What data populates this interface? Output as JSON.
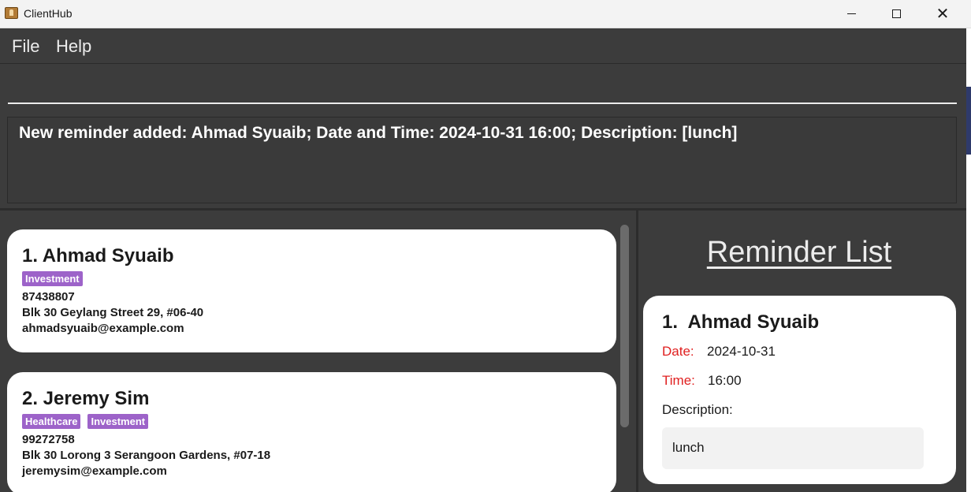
{
  "window": {
    "title": "ClientHub"
  },
  "menu": {
    "file": "File",
    "help": "Help"
  },
  "command": {
    "value": ""
  },
  "result": {
    "message": "New reminder added: Ahmad Syuaib; Date and Time: 2024-10-31 16:00; Description: [lunch]"
  },
  "persons": [
    {
      "index_name": "1. Ahmad Syuaib",
      "tags": [
        "Investment"
      ],
      "phone": "87438807",
      "address": "Blk 30 Geylang Street 29, #06-40",
      "email": "ahmadsyuaib@example.com"
    },
    {
      "index_name": "2. Jeremy Sim",
      "tags": [
        "Healthcare",
        "Investment"
      ],
      "phone": "99272758",
      "address": "Blk 30 Lorong 3 Serangoon Gardens, #07-18",
      "email": "jeremysim@example.com"
    }
  ],
  "reminders": {
    "heading": "Reminder List",
    "items": [
      {
        "index_name": "1.  Ahmad Syuaib",
        "date_label": "Date:",
        "date": "2024-10-31",
        "time_label": "Time:",
        "time": "16:00",
        "description_label": "Description:",
        "description": "lunch"
      }
    ]
  },
  "colors": {
    "background": "#3c3c3c",
    "tag": "#9d63c9",
    "label_red": "#e02020",
    "card": "#ffffff"
  },
  "icons": {
    "app": "app-icon",
    "minimize": "minimize-icon",
    "maximize": "maximize-icon",
    "close": "close-icon"
  }
}
